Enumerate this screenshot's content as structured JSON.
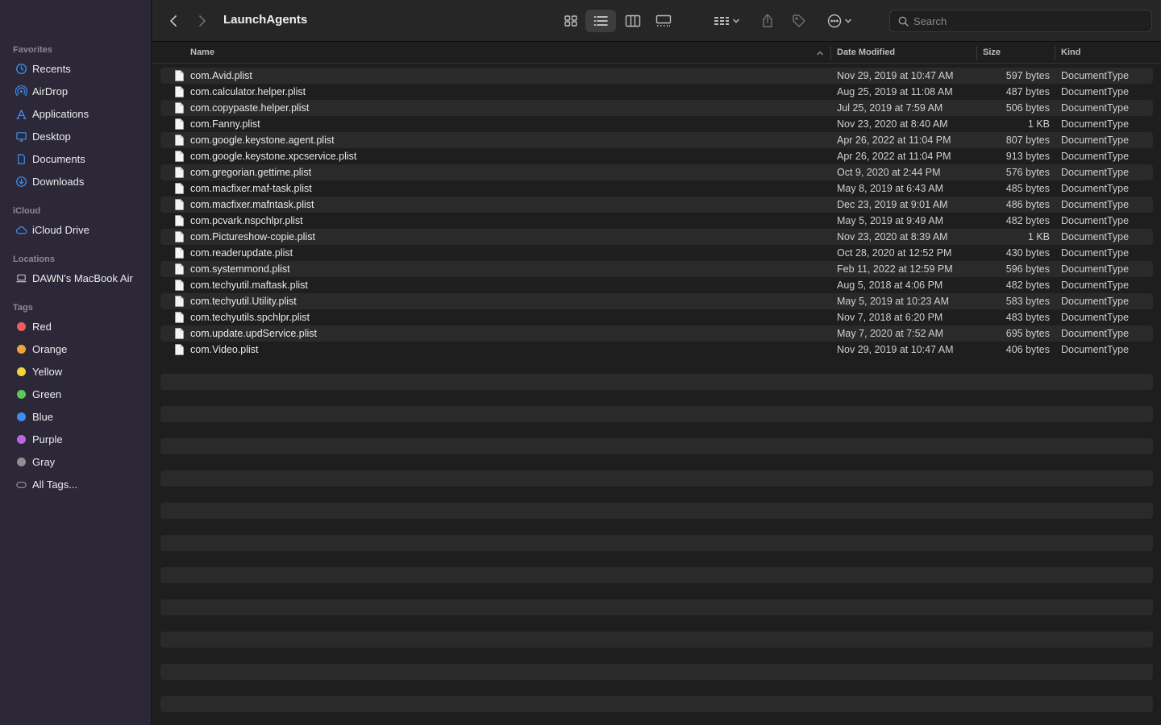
{
  "window": {
    "title": "LaunchAgents"
  },
  "sidebar": {
    "favorites_label": "Favorites",
    "favorites": [
      {
        "label": "Recents",
        "icon": "clock-icon"
      },
      {
        "label": "AirDrop",
        "icon": "airdrop-icon"
      },
      {
        "label": "Applications",
        "icon": "applications-icon"
      },
      {
        "label": "Desktop",
        "icon": "desktop-icon"
      },
      {
        "label": "Documents",
        "icon": "document-icon"
      },
      {
        "label": "Downloads",
        "icon": "download-icon"
      }
    ],
    "icloud_label": "iCloud",
    "icloud": [
      {
        "label": "iCloud Drive",
        "icon": "cloud-icon"
      }
    ],
    "locations_label": "Locations",
    "locations": [
      {
        "label": "DAWN's MacBook Air",
        "icon": "laptop-icon"
      }
    ],
    "tags_label": "Tags",
    "tags": [
      {
        "label": "Red",
        "color": "#ec5f5d"
      },
      {
        "label": "Orange",
        "color": "#f0a33b"
      },
      {
        "label": "Yellow",
        "color": "#f2d33b"
      },
      {
        "label": "Green",
        "color": "#5ac85a"
      },
      {
        "label": "Blue",
        "color": "#3d8ef2"
      },
      {
        "label": "Purple",
        "color": "#c064e0"
      },
      {
        "label": "Gray",
        "color": "#8e8e93"
      }
    ],
    "all_tags_label": "All Tags..."
  },
  "search": {
    "placeholder": "Search"
  },
  "columns": {
    "name": "Name",
    "date": "Date Modified",
    "size": "Size",
    "kind": "Kind"
  },
  "files": [
    {
      "name": "com.Avid.plist",
      "date": "Nov 29, 2019 at 10:47 AM",
      "size": "597 bytes",
      "kind": "DocumentType"
    },
    {
      "name": "com.calculator.helper.plist",
      "date": "Aug 25, 2019 at 11:08 AM",
      "size": "487 bytes",
      "kind": "DocumentType"
    },
    {
      "name": "com.copypaste.helper.plist",
      "date": "Jul 25, 2019 at 7:59 AM",
      "size": "506 bytes",
      "kind": "DocumentType"
    },
    {
      "name": "com.Fanny.plist",
      "date": "Nov 23, 2020 at 8:40 AM",
      "size": "1 KB",
      "kind": "DocumentType"
    },
    {
      "name": "com.google.keystone.agent.plist",
      "date": "Apr 26, 2022 at 11:04 PM",
      "size": "807 bytes",
      "kind": "DocumentType"
    },
    {
      "name": "com.google.keystone.xpcservice.plist",
      "date": "Apr 26, 2022 at 11:04 PM",
      "size": "913 bytes",
      "kind": "DocumentType"
    },
    {
      "name": "com.gregorian.gettime.plist",
      "date": "Oct 9, 2020 at 2:44 PM",
      "size": "576 bytes",
      "kind": "DocumentType"
    },
    {
      "name": "com.macfixer.maf-task.plist",
      "date": "May 8, 2019 at 6:43 AM",
      "size": "485 bytes",
      "kind": "DocumentType"
    },
    {
      "name": "com.macfixer.mafntask.plist",
      "date": "Dec 23, 2019 at 9:01 AM",
      "size": "486 bytes",
      "kind": "DocumentType"
    },
    {
      "name": "com.pcvark.nspchlpr.plist",
      "date": "May 5, 2019 at 9:49 AM",
      "size": "482 bytes",
      "kind": "DocumentType"
    },
    {
      "name": "com.Pictureshow-copie.plist",
      "date": "Nov 23, 2020 at 8:39 AM",
      "size": "1 KB",
      "kind": "DocumentType"
    },
    {
      "name": "com.readerupdate.plist",
      "date": "Oct 28, 2020 at 12:52 PM",
      "size": "430 bytes",
      "kind": "DocumentType"
    },
    {
      "name": "com.systemmond.plist",
      "date": "Feb 11, 2022 at 12:59 PM",
      "size": "596 bytes",
      "kind": "DocumentType"
    },
    {
      "name": "com.techyutil.maftask.plist",
      "date": "Aug 5, 2018 at 4:06 PM",
      "size": "482 bytes",
      "kind": "DocumentType"
    },
    {
      "name": "com.techyutil.Utility.plist",
      "date": "May 5, 2019 at 10:23 AM",
      "size": "583 bytes",
      "kind": "DocumentType"
    },
    {
      "name": "com.techyutils.spchlpr.plist",
      "date": "Nov 7, 2018 at 6:20 PM",
      "size": "483 bytes",
      "kind": "DocumentType"
    },
    {
      "name": "com.update.updService.plist",
      "date": "May 7, 2020 at 7:52 AM",
      "size": "695 bytes",
      "kind": "DocumentType"
    },
    {
      "name": "com.Video.plist",
      "date": "Nov 29, 2019 at 10:47 AM",
      "size": "406 bytes",
      "kind": "DocumentType"
    }
  ],
  "colors": {
    "accent": "#3d8ef2",
    "sidebar_bg": "#2c2838"
  }
}
